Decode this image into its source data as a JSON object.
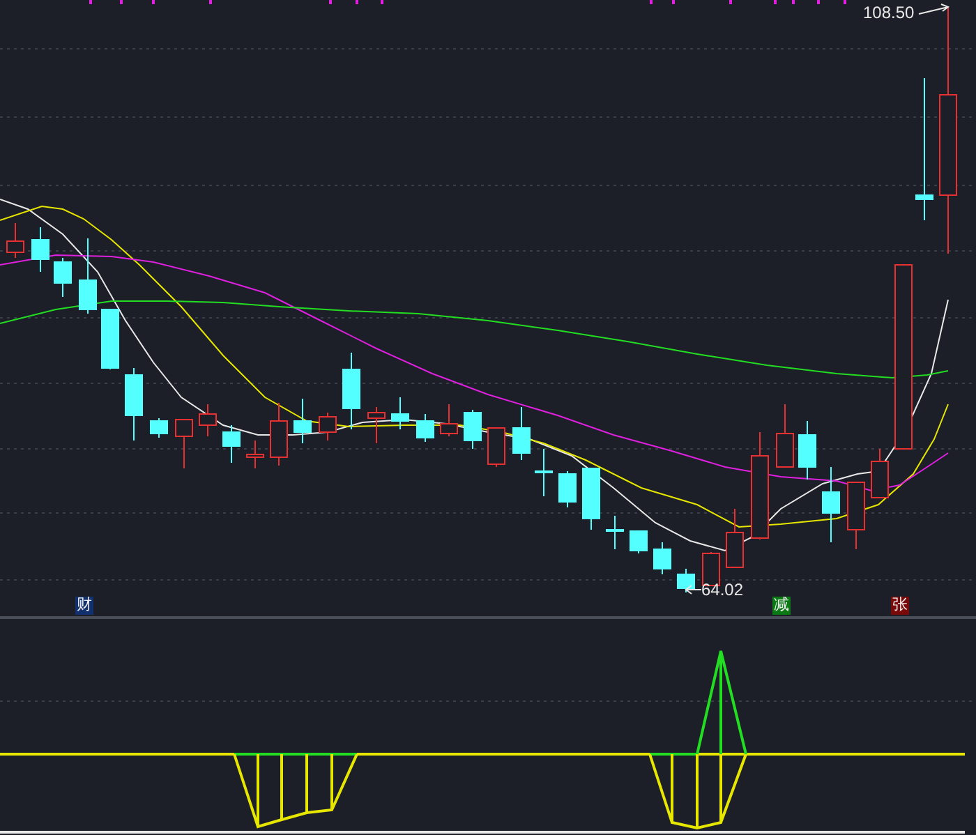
{
  "price_labels": [
    {
      "kind": "high",
      "text": "108.50"
    },
    {
      "kind": "low",
      "text": "64.02"
    }
  ],
  "event_markers": [
    {
      "label": "财",
      "color": "#13306e"
    },
    {
      "label": "减",
      "color": "#0b7a14"
    },
    {
      "label": "张",
      "color": "#7a0a0a"
    }
  ]
}
